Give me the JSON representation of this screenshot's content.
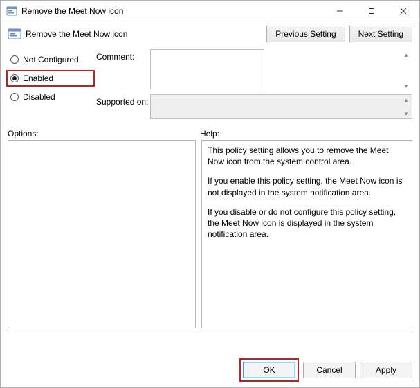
{
  "window": {
    "title": "Remove the Meet Now icon"
  },
  "header": {
    "title": "Remove the Meet Now icon",
    "prev_btn": "Previous Setting",
    "next_btn": "Next Setting"
  },
  "state": {
    "not_configured": "Not Configured",
    "enabled": "Enabled",
    "disabled": "Disabled",
    "selected": "enabled"
  },
  "fields": {
    "comment_label": "Comment:",
    "comment_value": "",
    "supported_label": "Supported on:",
    "supported_value": ""
  },
  "labels": {
    "options": "Options:",
    "help": "Help:"
  },
  "help": {
    "p1": "This policy setting allows you to remove the Meet Now icon from the system control area.",
    "p2": "If you enable this policy setting, the Meet Now icon is not displayed in the system notification area.",
    "p3": "If you disable or do not configure this policy setting, the Meet Now icon is displayed in the system notification area."
  },
  "buttons": {
    "ok": "OK",
    "cancel": "Cancel",
    "apply": "Apply"
  }
}
